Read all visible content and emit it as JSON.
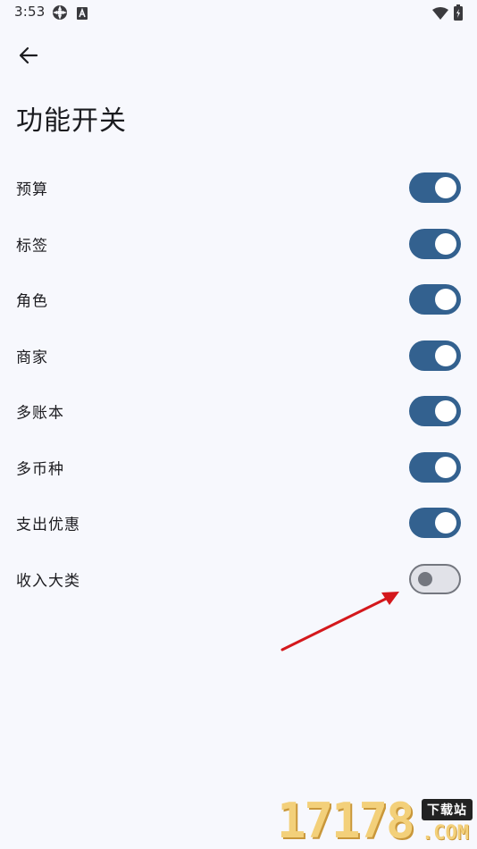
{
  "status_bar": {
    "time": "3:53",
    "left_icons": [
      "settings-gear-icon",
      "a-letter-icon"
    ],
    "right_icons": [
      "wifi-icon",
      "battery-icon"
    ]
  },
  "header": {
    "back_icon": "arrow-left-icon",
    "title": "功能开关"
  },
  "toggles": [
    {
      "label": "预算",
      "on": true
    },
    {
      "label": "标签",
      "on": true
    },
    {
      "label": "角色",
      "on": true
    },
    {
      "label": "商家",
      "on": true
    },
    {
      "label": "多账本",
      "on": true
    },
    {
      "label": "多币种",
      "on": true
    },
    {
      "label": "支出优惠",
      "on": true
    },
    {
      "label": "收入大类",
      "on": false
    }
  ],
  "colors": {
    "background": "#f7f8fd",
    "switch_on": "#33618f",
    "switch_off_track": "#e1e2e8",
    "switch_off_outline": "#74777f",
    "annotation_arrow": "#d4181c"
  },
  "watermark": {
    "digits": "17178",
    "tag": "下载站",
    "suffix": ".COM"
  }
}
